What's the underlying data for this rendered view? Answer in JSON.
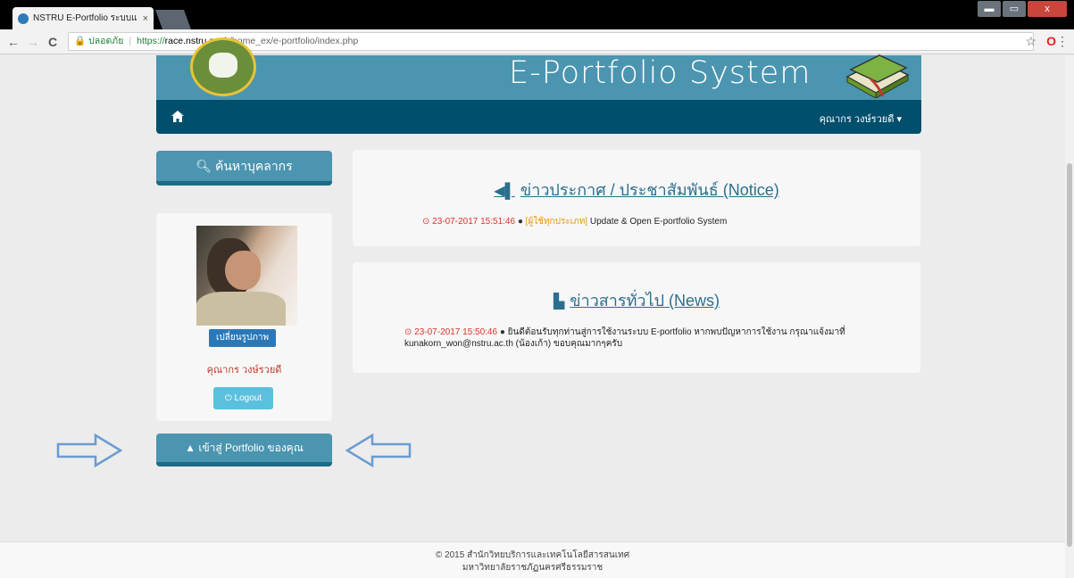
{
  "browser": {
    "tab_title": "NSTRU E-Portfolio ระบบแ",
    "tab_close": "×",
    "win_min": "▬",
    "win_restore": "▭",
    "win_close": "x",
    "back": "←",
    "forward": "→",
    "reload": "C",
    "secure_label": "ปลอดภัย",
    "url_protocol": "https://",
    "url_host": "race.nstru.ac.th",
    "url_path": "/home_ex/e-portfolio/index.php",
    "bookmark_star": "☆",
    "opera_icon": "O",
    "menu_icon": "⋮"
  },
  "header": {
    "title": "E-Portfolio System"
  },
  "navbar": {
    "home_icon": "home-icon",
    "user_menu_label": "คุณากร วงษ์รวยดี",
    "caret": "▾"
  },
  "sidebar": {
    "search_button": "ค้นหาบุคลากร",
    "change_photo_button": "เปลี่ยนรูปภาพ",
    "profile_name": "คุณากร วงษ์รวยดี",
    "logout_button": "Logout",
    "portfolio_button": "เข้าสู่ Portfolio ของคุณ"
  },
  "notice": {
    "heading": "ข่าวประกาศ / ประชาสัมพันธ์ (Notice)",
    "items": [
      {
        "datetime": "23-07-2017 15:51:46",
        "audience": "[ผู้ใช้ทุกประเภท]",
        "text": "Update & Open E-portfolio System"
      }
    ]
  },
  "news": {
    "heading": "ข่าวสารทั่วไป (News)",
    "items": [
      {
        "datetime": "23-07-2017 15:50:46",
        "text": "ยินดีต้อนรับทุกท่านสู่การใช้งานระบบ E-portfolio หากพบปัญหาการใช้งาน กรุณาแจ้งมาที่ kunakorn_won@nstru.ac.th (น้องเก้า) ขอบคุณมากๆครับ"
      }
    ]
  },
  "footer": {
    "line1": "© 2015 สำนักวิทยบริการและเทคโนโลยีสารสนเทศ",
    "line2": "มหาวิทยาลัยราชภัฏนครศรีธรรมราช"
  },
  "colors": {
    "banner": "#4b95b0",
    "navbar": "#004f6d",
    "accent_red": "#d9342b",
    "logout": "#5bc0de"
  }
}
